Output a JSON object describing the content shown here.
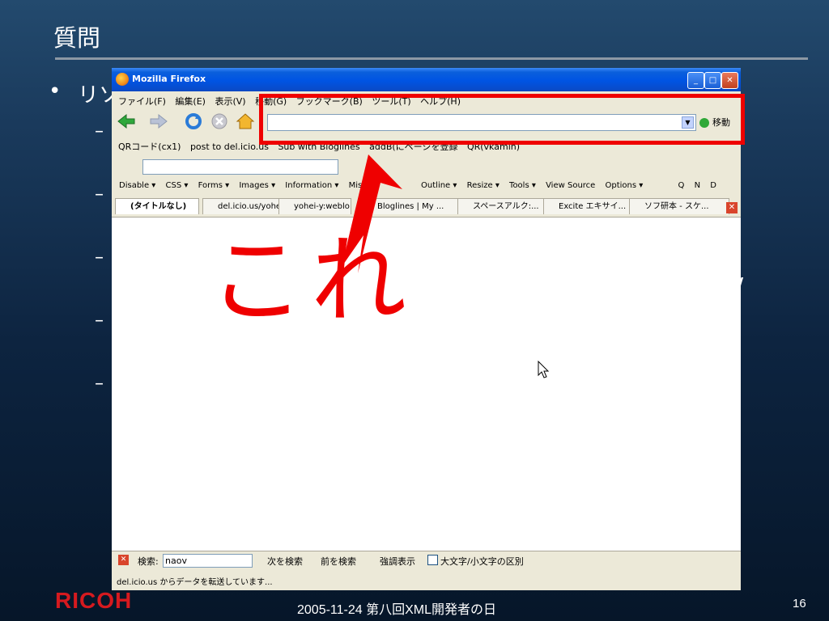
{
  "slide": {
    "title": "質問",
    "bullet": "リソ",
    "dash": "–",
    "slash": "/",
    "company_logo": "RICOH",
    "footer_text": "2005-11-24 第八回XML開発者の日",
    "page_number": "16"
  },
  "browser": {
    "window_title": "Mozilla Firefox",
    "window_buttons": {
      "minimize": "_",
      "maximize": "□",
      "close": "✕"
    },
    "menu": [
      "ファイル(F)",
      "編集(E)",
      "表示(V)",
      "移動(G)",
      "ブックマーク(B)",
      "ツール(T)",
      "ヘルプ(H)"
    ],
    "url_value": "",
    "go_label": "移動",
    "bookmarks": [
      "QRコード(cx1)",
      "post to del.icio.us",
      "Sub with Bloglines",
      "addB(にページを登録",
      "QR(vkamin)"
    ],
    "dev_toolbar": [
      "Disable ▾",
      "CSS ▾",
      "Forms ▾",
      "Images ▾",
      "Information ▾",
      "Misce",
      "Outline ▾",
      "Resize ▾",
      "Tools ▾",
      "View Source",
      "Options ▾"
    ],
    "dev_toolbar_right": [
      "Q",
      "N",
      "D"
    ],
    "tabs": [
      "(タイトルなし)",
      "del.icio.us/yohei",
      "yohei-y:weblo",
      "Bloglines | My ...",
      "スペースアルク:...",
      "Excite エキサイ...",
      "ソフ研本 - スケ..."
    ],
    "find_bar": {
      "label": "検索:",
      "value": "naov",
      "next": "次を検索",
      "previous": "前を検索",
      "highlight": "強調表示",
      "match_case": "大文字/小文字の区別"
    },
    "status_text": "del.icio.us からデータを転送しています..."
  },
  "annotation": {
    "text": "これ",
    "color": "#ef0000"
  }
}
